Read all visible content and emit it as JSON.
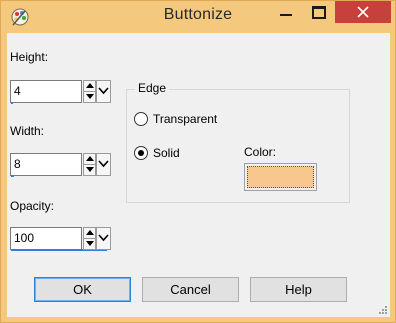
{
  "window": {
    "title": "Buttonize"
  },
  "height": {
    "label": "Height:",
    "value": "4"
  },
  "width": {
    "label": "Width:",
    "value": "8"
  },
  "opacity": {
    "label": "Opacity:",
    "value": "100"
  },
  "edge": {
    "title": "Edge",
    "options": [
      {
        "label": "Transparent",
        "selected": false
      },
      {
        "label": "Solid",
        "selected": true
      }
    ],
    "color_label": "Color:",
    "color_value": "#f7c78e"
  },
  "buttons": {
    "ok": "OK",
    "cancel": "Cancel",
    "help": "Help"
  },
  "colors": {
    "titlebar": "#f4c97e",
    "close": "#c7403b",
    "dialog": "#f0f0f0",
    "accent": "#2f7fd6"
  },
  "icons": [
    "app-icon",
    "minimize-icon",
    "maximize-icon",
    "close-icon",
    "spin-up-icon",
    "spin-down-icon",
    "chevron-down-icon",
    "resize-grip-icon"
  ]
}
